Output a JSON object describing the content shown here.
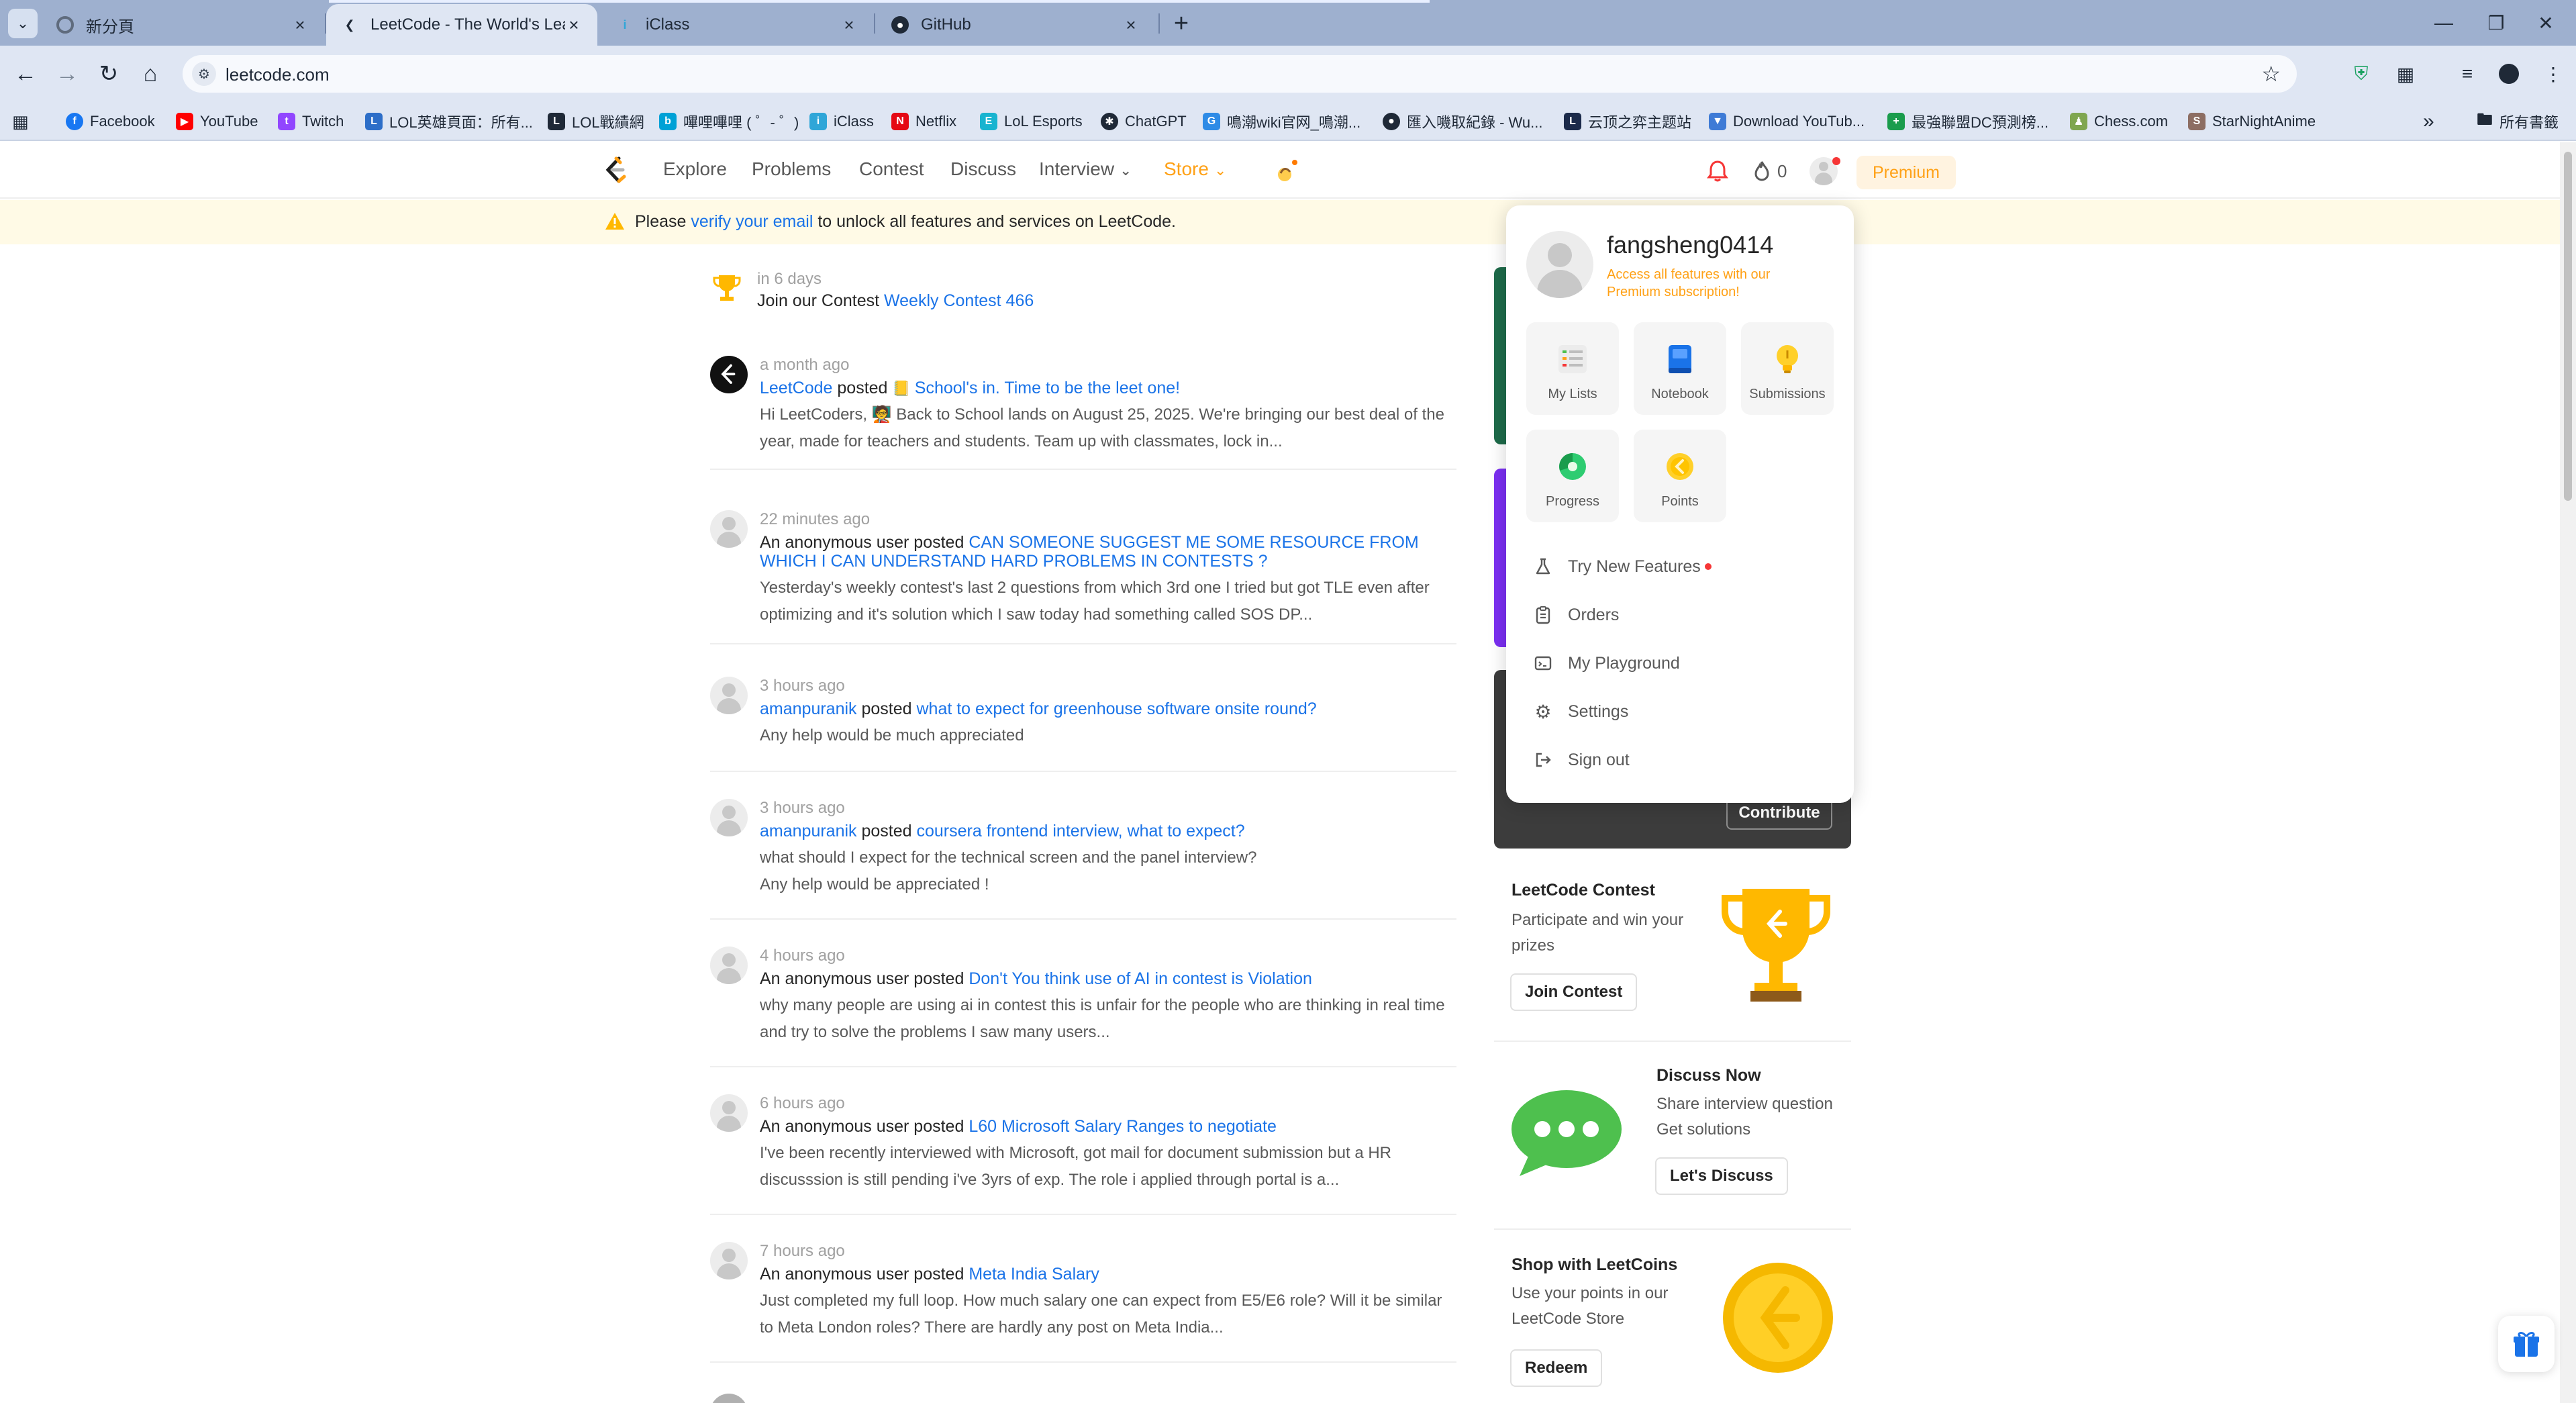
{
  "browser": {
    "tabs": [
      {
        "title": "新分頁"
      },
      {
        "title": "LeetCode - The World's Leadi"
      },
      {
        "title": "iClass"
      },
      {
        "title": "GitHub"
      }
    ],
    "url": "leetcode.com",
    "bookmarks": [
      {
        "label": "Facebook"
      },
      {
        "label": "YouTube"
      },
      {
        "label": "Twitch"
      },
      {
        "label": "LOL英雄頁面：所有..."
      },
      {
        "label": "LOL戰績網"
      },
      {
        "label": "嗶哩嗶哩 ( ゜- ゜)"
      },
      {
        "label": "iClass"
      },
      {
        "label": "Netflix"
      },
      {
        "label": "LoL Esports"
      },
      {
        "label": "ChatGPT"
      },
      {
        "label": "鳴潮wiki官网_鳴潮..."
      },
      {
        "label": "匯入嘰取紀錄 - Wu..."
      },
      {
        "label": "云顶之弈主题站"
      },
      {
        "label": "Download YouTub..."
      },
      {
        "label": "最強聯盟DC預測榜..."
      },
      {
        "label": "Chess.com"
      },
      {
        "label": "StarNightAnime"
      }
    ],
    "bookmarks_more": "»",
    "all_bookmarks": "所有書籤",
    "accent": "#9eb0cf"
  },
  "nav": {
    "items": [
      "Explore",
      "Problems",
      "Contest",
      "Discuss",
      "Interview",
      "Store"
    ],
    "streak": "0",
    "premium": "Premium",
    "brand_color": "#ffa116"
  },
  "banner": {
    "before": "Please ",
    "link": "verify your email",
    "after": " to unlock all features and services on LeetCode."
  },
  "contest_notice": {
    "time": "in 6 days",
    "text": "Join our Contest ",
    "link": "Weekly Contest 466"
  },
  "feed": [
    {
      "time": "a month ago",
      "author": "LeetCode",
      "verb": " posted ",
      "title": "School's in. Time to be the leet one!",
      "body": "Hi LeetCoders, 🧑‍🏫 Back to School lands on August 25, 2025. We're bringing our best deal of the year, made for teachers and students. Team up with classmates, lock in..."
    },
    {
      "time": "22 minutes ago",
      "author": "An anonymous user",
      "verb": " posted ",
      "title": "CAN SOMEONE SUGGEST ME SOME RESOURCE FROM WHICH I CAN UNDERSTAND HARD PROBLEMS IN CONTESTS ?",
      "body": "Yesterday's weekly contest's last 2 questions from which 3rd one I tried but got TLE even after optimizing and it's solution which I saw today had something called SOS DP..."
    },
    {
      "time": "3 hours ago",
      "author": "amanpuranik",
      "verb": " posted ",
      "title": "what to expect for greenhouse software onsite round?",
      "body": "Any help would be much appreciated"
    },
    {
      "time": "3 hours ago",
      "author": "amanpuranik",
      "verb": " posted ",
      "title": "coursera frontend interview, what to expect?",
      "body": "what should I expect for the technical screen and the panel interview?\nAny help would be appreciated !"
    },
    {
      "time": "4 hours ago",
      "author": "An anonymous user",
      "verb": " posted ",
      "title": "Don't You think use of AI in contest is Violation",
      "body": "why many people are using ai in contest this is unfair for the people who are thinking in real time and try to solve the problems I saw many users..."
    },
    {
      "time": "6 hours ago",
      "author": "An anonymous user",
      "verb": " posted ",
      "title": "L60 Microsoft Salary Ranges to negotiate",
      "body": "I've been recently interviewed with Microsoft, got mail for document submission but a HR discusssion is still pending i've 3yrs of exp. The role i applied through portal is a..."
    },
    {
      "time": "7 hours ago",
      "author": "An anonymous user",
      "verb": " posted ",
      "title": "Meta India Salary",
      "body": "Just completed my full loop. How much salary one can expect from E5/E6 role? Will it be similar to Meta London roles? There are hardly any post on Meta India..."
    }
  ],
  "side": {
    "contribute": "Contribute",
    "contest": {
      "title": "LeetCode Contest",
      "text": "Participate and win your prizes",
      "button": "Join Contest"
    },
    "discuss": {
      "title": "Discuss Now",
      "text": "Share interview question Get solutions",
      "button": "Let's Discuss"
    },
    "shop": {
      "title": "Shop with LeetCoins",
      "text": "Use your points in our LeetCode Store",
      "button": "Redeem"
    }
  },
  "dropdown": {
    "username": "fangsheng0414",
    "subtitle": "Access all features with our Premium subscription!",
    "tiles": [
      {
        "label": "My Lists",
        "icon": "list-icon"
      },
      {
        "label": "Notebook",
        "icon": "notebook-icon"
      },
      {
        "label": "Submissions",
        "icon": "lightbulb-icon"
      },
      {
        "label": "Progress",
        "icon": "progress-icon"
      },
      {
        "label": "Points",
        "icon": "coin-icon"
      }
    ],
    "menu": [
      {
        "label": "Try New Features",
        "icon": "flask-icon"
      },
      {
        "label": "Orders",
        "icon": "clipboard-icon"
      },
      {
        "label": "My Playground",
        "icon": "playground-icon"
      },
      {
        "label": "Settings",
        "icon": "gear-icon"
      },
      {
        "label": "Sign out",
        "icon": "sign-out-icon"
      }
    ]
  }
}
